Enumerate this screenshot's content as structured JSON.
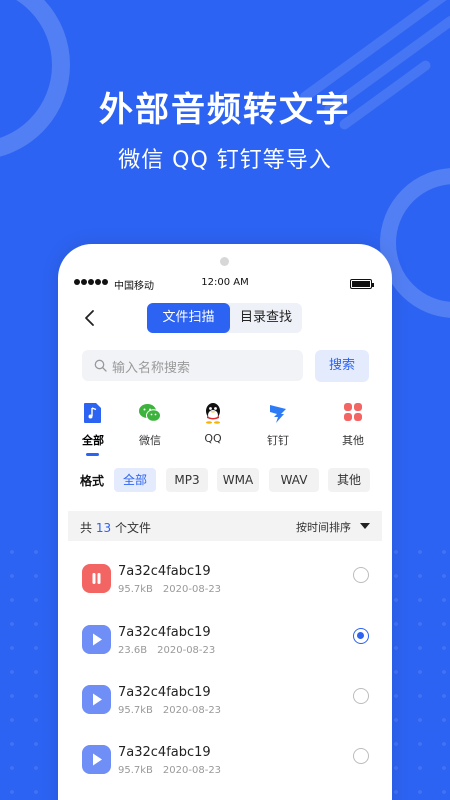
{
  "promo": {
    "headline": "外部音频转文字",
    "subline": "微信 QQ 钉钉等导入"
  },
  "status_bar": {
    "carrier": "中国移动",
    "time": "12:00 AM"
  },
  "nav": {
    "tabs": [
      {
        "label": "文件扫描",
        "active": true
      },
      {
        "label": "目录查找",
        "active": false
      }
    ]
  },
  "search": {
    "placeholder": "输入名称搜索",
    "button": "搜索"
  },
  "sources": [
    {
      "label": "全部",
      "icon": "music-note-icon",
      "active": true
    },
    {
      "label": "微信",
      "icon": "wechat-icon",
      "active": false
    },
    {
      "label": "QQ",
      "icon": "qq-penguin-icon",
      "active": false
    },
    {
      "label": "钉钉",
      "icon": "dingtalk-icon",
      "active": false
    },
    {
      "label": "其他",
      "icon": "grid-icon",
      "active": false
    }
  ],
  "formats": {
    "label": "格式",
    "chips": [
      {
        "label": "全部",
        "active": true
      },
      {
        "label": "MP3",
        "active": false
      },
      {
        "label": "WMA",
        "active": false
      },
      {
        "label": "WAV",
        "active": false
      },
      {
        "label": "其他",
        "active": false
      }
    ]
  },
  "list_header": {
    "prefix": "共",
    "count": "13",
    "suffix": "个文件",
    "sort": "按时间排序"
  },
  "files": [
    {
      "name": "7a32c4fabc19",
      "size": "95.7kB",
      "date": "2020-08-23",
      "state": "paused",
      "selected": false
    },
    {
      "name": "7a32c4fabc19",
      "size": "23.6B",
      "date": "2020-08-23",
      "state": "play",
      "selected": true
    },
    {
      "name": "7a32c4fabc19",
      "size": "95.7kB",
      "date": "2020-08-23",
      "state": "play",
      "selected": false
    },
    {
      "name": "7a32c4fabc19",
      "size": "95.7kB",
      "date": "2020-08-23",
      "state": "play",
      "selected": false
    }
  ],
  "colors": {
    "accent": "#2d63f2",
    "paused": "#f36563",
    "play": "#6f8ef6"
  }
}
